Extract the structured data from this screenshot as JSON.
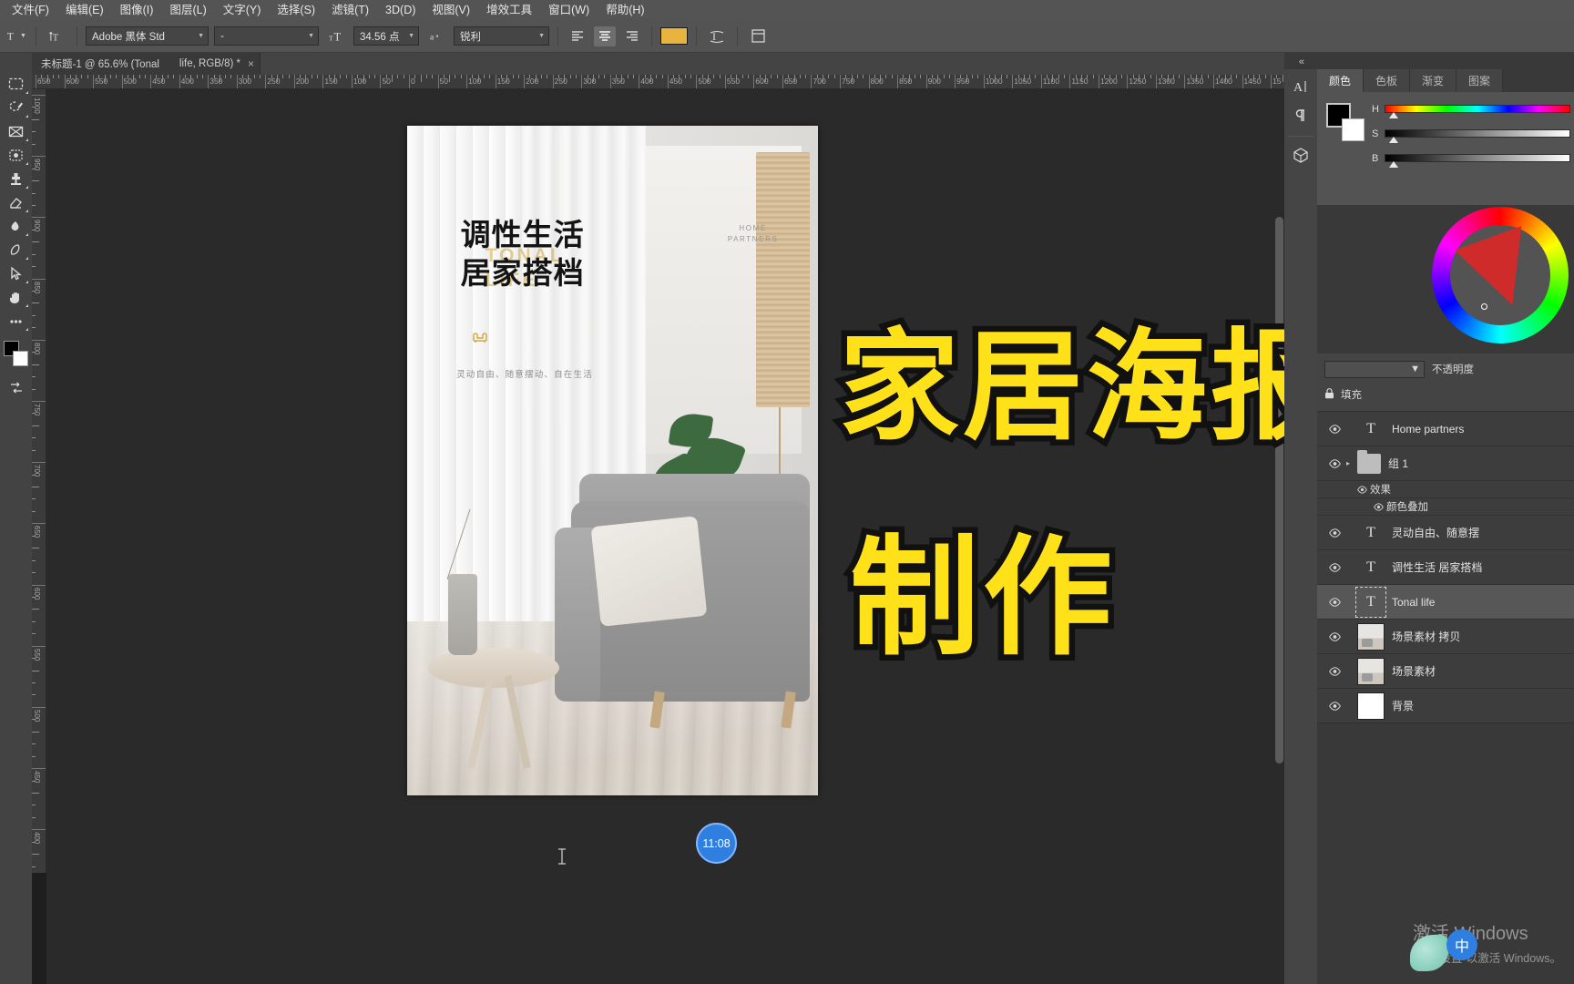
{
  "menu": {
    "items": [
      "文件(F)",
      "编辑(E)",
      "图像(I)",
      "图层(L)",
      "文字(Y)",
      "选择(S)",
      "滤镜(T)",
      "3D(D)",
      "视图(V)",
      "增效工具",
      "窗口(W)",
      "帮助(H)"
    ]
  },
  "options_bar": {
    "tool_icon": "text-tool-icon",
    "orientation_icon": "text-orientation-icon",
    "font_family": "Adobe 黑体 Std",
    "font_style": "-",
    "font_size": "34.56 点",
    "antialias_icon": "anti-alias-icon",
    "antialias": "锐利",
    "align_left_icon": "align-left-icon",
    "align_center_icon": "align-center-icon",
    "align_right_icon": "align-right-icon",
    "color_swatch": "#e8b33f",
    "warp_icon": "warp-text-icon",
    "panel_icon": "character-panel-icon"
  },
  "document_tab": {
    "title": "未标题-1 @ 65.6% (Tonal",
    "subtitle": "life, RGB/8) *",
    "close": "×"
  },
  "toolbar": {
    "tools": [
      {
        "name": "marquee-tool",
        "icon": "marquee"
      },
      {
        "name": "lasso-tool",
        "icon": "lasso"
      },
      {
        "name": "crop-tool",
        "icon": "frame"
      },
      {
        "name": "quick-selection-tool",
        "icon": "quickselect"
      },
      {
        "name": "clone-stamp-tool",
        "icon": "stamp"
      },
      {
        "name": "eraser-tool",
        "icon": "eraser"
      },
      {
        "name": "blur-tool",
        "icon": "blur"
      },
      {
        "name": "pen-tool",
        "icon": "pen"
      },
      {
        "name": "path-selection-tool",
        "icon": "arrow"
      },
      {
        "name": "hand-tool",
        "icon": "hand"
      },
      {
        "name": "edit-toolbar",
        "icon": "dots"
      }
    ],
    "foreground_color": "#000000",
    "background_color": "#ffffff",
    "quickmask_icon": "quick-mask-icon"
  },
  "ruler": {
    "h_labels": [
      "650",
      "600",
      "550",
      "500",
      "450",
      "400",
      "350",
      "300",
      "250",
      "200",
      "150",
      "100",
      "50",
      "0",
      "50",
      "100",
      "150",
      "200",
      "250",
      "300",
      "350",
      "400",
      "450",
      "500",
      "550",
      "600",
      "650",
      "700",
      "750",
      "800",
      "850",
      "900",
      "950",
      "1000",
      "1050",
      "1100",
      "1150",
      "1200",
      "1250",
      "1300",
      "1350",
      "1400",
      "1450",
      "15"
    ],
    "v_labels": [
      "1000",
      "950",
      "900",
      "850",
      "800",
      "750",
      "700",
      "650",
      "600",
      "550",
      "500",
      "450",
      "400"
    ]
  },
  "canvas": {
    "zoom": "65.6%",
    "poster": {
      "title_line1": "调性生活",
      "title_line2": "居家搭档",
      "ghost_line1": "TONAL",
      "ghost_line2": "LIFE",
      "sofa_icon": "sofa-icon",
      "subtitle": "灵动自由、随意摆动、自在生活",
      "brand_line1": "HOME",
      "brand_line2": "PARTNERS"
    },
    "time_bubble": "11:08",
    "text_cursor_marker": "text-insert-cursor"
  },
  "overlay": {
    "line1": "家居海报",
    "line2": "制作",
    "color": "#ffe11a",
    "stroke_color": "#111111"
  },
  "right_dock": {
    "collapse_icon": "collapse-panels-icon",
    "rail_icons": [
      {
        "name": "character-panel-icon",
        "glyph": "A|"
      },
      {
        "name": "paragraph-panel-icon",
        "glyph": "¶"
      },
      {
        "name": "3d-panel-icon",
        "glyph": "cube"
      }
    ],
    "color_panel": {
      "tabs": [
        "颜色",
        "色板",
        "渐变",
        "图案"
      ],
      "active_tab": "颜色",
      "foreground": "#000000",
      "background": "#ffffff",
      "sliders": [
        {
          "label": "H",
          "type": "hue"
        },
        {
          "label": "S",
          "type": "saturation"
        },
        {
          "label": "B",
          "type": "brightness"
        }
      ],
      "wheel": "color-wheel"
    },
    "layers_panel": {
      "opacity_label": "不透明度",
      "fill_label": "填充",
      "lock_icon": "lock-icon",
      "rows": [
        {
          "name": "Home partners",
          "type": "text",
          "visible": true,
          "selected": false,
          "indent": 0
        },
        {
          "name": "组 1",
          "type": "group",
          "visible": true,
          "selected": false,
          "indent": 0,
          "expandable": true
        },
        {
          "name": "效果",
          "type": "effect",
          "visible": true,
          "selected": false,
          "indent": 1
        },
        {
          "name": "颜色叠加",
          "type": "effect",
          "visible": true,
          "selected": false,
          "indent": 2
        },
        {
          "name": "灵动自由、随意摆",
          "type": "text",
          "visible": true,
          "selected": false,
          "indent": 0
        },
        {
          "name": "调性生活 居家搭档",
          "type": "text",
          "visible": true,
          "selected": false,
          "indent": 0
        },
        {
          "name": "Tonal        life",
          "type": "text",
          "visible": true,
          "selected": true,
          "indent": 0
        },
        {
          "name": "场景素材 拷贝",
          "type": "image",
          "visible": true,
          "selected": false,
          "indent": 0
        },
        {
          "name": "场景素材",
          "type": "image",
          "visible": true,
          "selected": false,
          "indent": 0
        },
        {
          "name": "背景",
          "type": "background",
          "visible": true,
          "selected": false,
          "indent": 0
        }
      ]
    }
  },
  "watermark": {
    "line1": "激活 Windows",
    "line2": "转到\"设置\"以激活 Windows。"
  },
  "ime": {
    "mode": "中"
  }
}
